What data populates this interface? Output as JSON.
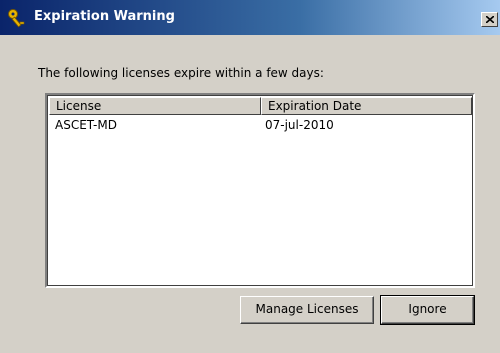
{
  "window": {
    "title": "Expiration Warning",
    "title_icon": "key-icon",
    "close_icon": "close-icon"
  },
  "message": "The following licenses expire within a few days:",
  "table": {
    "columns": [
      "License",
      "Expiration Date"
    ],
    "rows": [
      {
        "license": "ASCET-MD",
        "expiration_date": "07-jul-2010"
      }
    ]
  },
  "buttons": {
    "manage_licenses": "Manage Licenses",
    "ignore": "Ignore"
  },
  "colors": {
    "titlebar_start": "#0a246a",
    "titlebar_end": "#a6caf0",
    "dialog_face": "#d4d0c8"
  }
}
